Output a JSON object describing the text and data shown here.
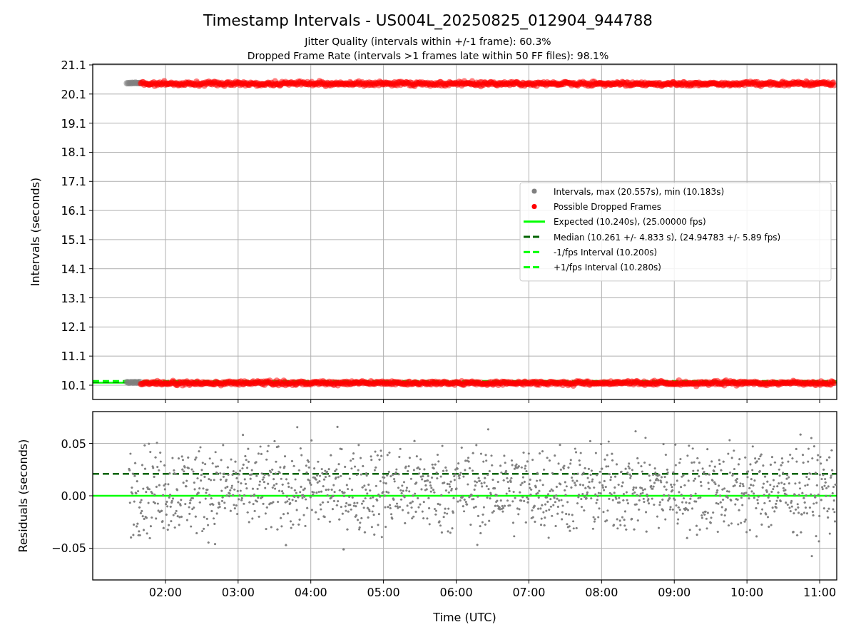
{
  "figure": {
    "title": "Timestamp Intervals - US004L_20250825_012904_944788",
    "subtitles": [
      "Jitter Quality (intervals within +/-1 frame): 60.3%",
      "Dropped Frame Rate (intervals >1 frames late within 50 FF files): 98.1%"
    ]
  },
  "intervals_plot": {
    "ylabel": "Intervals (seconds)",
    "y_tick_labels": [
      "21.1",
      "20.1",
      "19.1",
      "18.1",
      "17.1",
      "16.1",
      "15.1",
      "14.1",
      "13.1",
      "12.1",
      "11.1",
      "10.1"
    ],
    "legend": [
      {
        "kind": "marker",
        "label": "Intervals, max (20.557s), min (10.183s)",
        "color": "#808080"
      },
      {
        "kind": "marker",
        "label": "Possible Dropped Frames",
        "color": "#ff0000"
      },
      {
        "kind": "solid",
        "label": "Expected (10.240s), (25.00000 fps)",
        "color": "#00ff00"
      },
      {
        "kind": "dashed",
        "label": "Median (10.261 +/- 4.833 s), (24.94783 +/- 5.89 fps)",
        "color": "#006400"
      },
      {
        "kind": "dashed",
        "label": "-1/fps Interval (10.200s)",
        "color": "#00ff00"
      },
      {
        "kind": "dashed",
        "label": "+1/fps Interval (10.280s)",
        "color": "#00ff00"
      }
    ]
  },
  "residuals_plot": {
    "chart_data": {
      "type": "line",
      "xlabel": "Time (UTC)",
      "ylabel": "Residuals (seconds)",
      "x": [
        1.0,
        11.235
      ],
      "xlim": [
        1.0,
        11.235
      ],
      "ylim": [
        -0.0803,
        0.0803
      ],
      "grid": true,
      "xticks": [
        {
          "value": 2,
          "label": "02:00"
        },
        {
          "value": 3,
          "label": "03:00"
        },
        {
          "value": 4,
          "label": "04:00"
        },
        {
          "value": 5,
          "label": "05:00"
        },
        {
          "value": 6,
          "label": "06:00"
        },
        {
          "value": 7,
          "label": "07:00"
        },
        {
          "value": 8,
          "label": "08:00"
        },
        {
          "value": 9,
          "label": "09:00"
        },
        {
          "value": 10,
          "label": "10:00"
        },
        {
          "value": 11,
          "label": "11:00"
        }
      ],
      "yticks": [
        {
          "value": 0.05,
          "label": "0.05"
        },
        {
          "value": 0,
          "label": "0.00"
        },
        {
          "value": -0.05,
          "label": "−0.05"
        }
      ],
      "series": [
        {
          "color": "#00ff00",
          "line_style": "solid",
          "values": [
            0,
            0
          ]
        },
        {
          "color": "#006400",
          "line_style": "dashed",
          "values": [
            0.021,
            0.021
          ]
        }
      ]
    }
  }
}
